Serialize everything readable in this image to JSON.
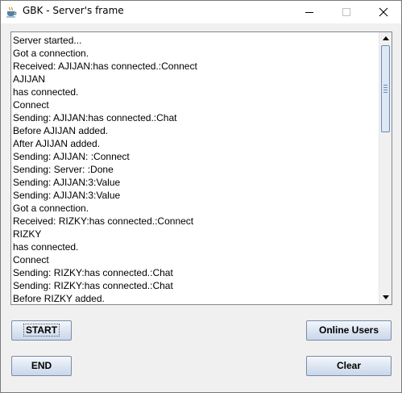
{
  "window": {
    "title": "GBK - Server's frame",
    "icon": "java-cup-icon"
  },
  "console": {
    "lines": [
      "Server started...",
      "Got a connection.",
      "Received: AJIJAN:has connected.:Connect",
      "AJIJAN",
      "has connected.",
      "Connect",
      "Sending: AJIJAN:has connected.:Chat",
      "Before AJIJAN added.",
      "After AJIJAN added.",
      "Sending: AJIJAN: :Connect",
      "Sending: Server: :Done",
      "Sending: AJIJAN:3:Value",
      "Sending: AJIJAN:3:Value",
      "Got a connection.",
      "Received: RIZKY:has connected.:Connect",
      "RIZKY",
      "has connected.",
      "Connect",
      "Sending: RIZKY:has connected.:Chat",
      "Sending: RIZKY:has connected.:Chat",
      "Before RIZKY added."
    ]
  },
  "buttons": {
    "start": "START",
    "online_users": "Online Users",
    "end": "END",
    "clear": "Clear"
  }
}
